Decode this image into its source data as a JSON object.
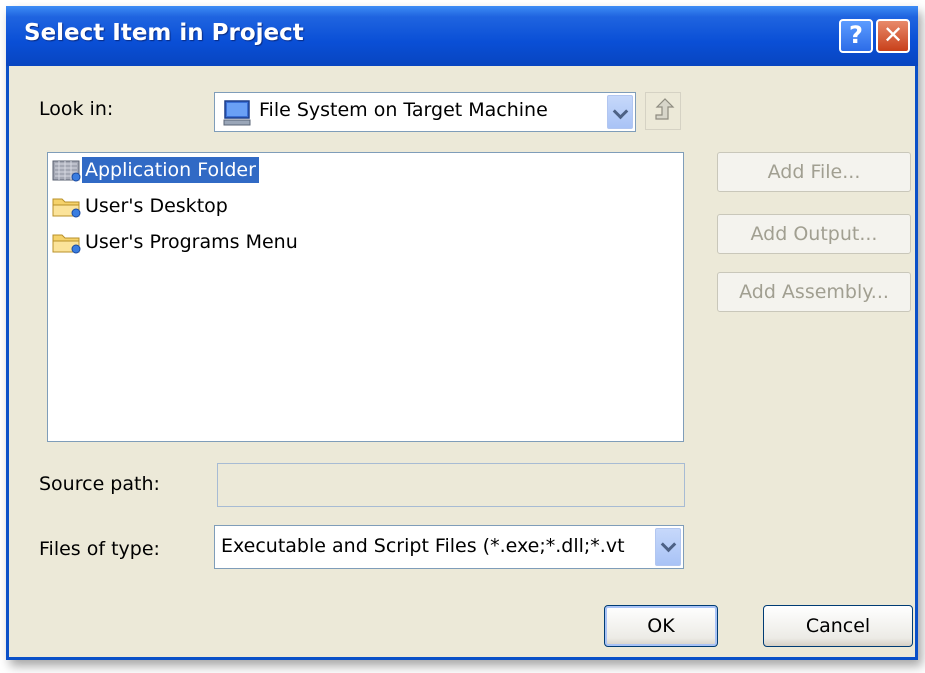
{
  "window": {
    "title": "Select Item in Project"
  },
  "title_buttons": {
    "help": "?",
    "close": "✕"
  },
  "look_in": {
    "label": "Look in:",
    "value": "File System on Target Machine"
  },
  "list": {
    "items": [
      {
        "label": "Application Folder",
        "selected": true
      },
      {
        "label": "User's Desktop",
        "selected": false
      },
      {
        "label": "User's Programs Menu",
        "selected": false
      }
    ]
  },
  "side_buttons": {
    "add_file": "Add File...",
    "add_output": "Add Output...",
    "add_assembly": "Add Assembly..."
  },
  "source_path": {
    "label": "Source path:",
    "value": ""
  },
  "files_of_type": {
    "label": "Files of type:",
    "value": "Executable and Script Files (*.exe;*.dll;*.vt"
  },
  "buttons": {
    "ok": "OK",
    "cancel": "Cancel"
  },
  "colors": {
    "titlebar": "#0a4fd6",
    "selection": "#316ac5",
    "dialog_bg": "#ece9d8",
    "disabled_text": "#a19f91"
  }
}
